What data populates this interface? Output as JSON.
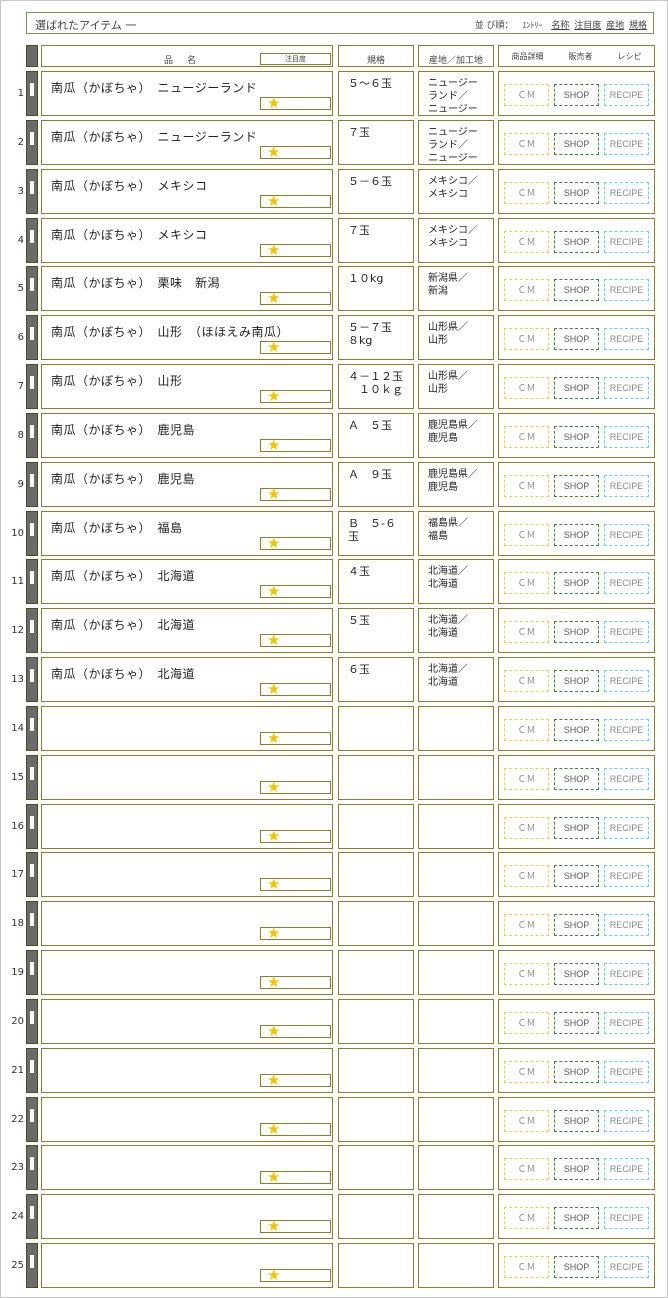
{
  "header": {
    "title": "選ばれたアイテム 一",
    "sort_prefix": "並 び順：",
    "sort_entry": "ｴﾝﾄﾘｰ",
    "sort_options": [
      "名称",
      "注目度",
      "産地",
      "規格"
    ]
  },
  "columns": {
    "name": "品名",
    "attention": "注目度",
    "spec": "規格",
    "origin": "産地／加工地",
    "detail": "商品詳細",
    "seller": "販売者",
    "recipe": "レシピ"
  },
  "buttons": {
    "cm": "ＣＭ",
    "shop": "SHOP",
    "recipe": "RECIPE"
  },
  "rows": [
    {
      "num": "1",
      "name": "南瓜（かぼちゃ）　ニュージーランド",
      "spec": "５～６玉",
      "origin": "ニュージー\nランド／\nニュージー"
    },
    {
      "num": "2",
      "name": "南瓜（かぼちゃ）　ニュージーランド",
      "spec": "７玉",
      "origin": "ニュージー\nランド／\nニュージー"
    },
    {
      "num": "3",
      "name": "南瓜（かぼちゃ）　メキシコ",
      "spec": "５－６玉",
      "origin": "メキシコ／\nメキシコ"
    },
    {
      "num": "4",
      "name": "南瓜（かぼちゃ）　メキシコ",
      "spec": "７玉",
      "origin": "メキシコ／\nメキシコ"
    },
    {
      "num": "5",
      "name": "南瓜（かぼちゃ）　栗味　新潟",
      "spec": "１０kg",
      "origin": "新潟県／\n新潟"
    },
    {
      "num": "6",
      "name": "南瓜（かぼちゃ）　山形　（ほほえみ南瓜）",
      "spec": "５－７玉\n８kg",
      "origin": "山形県／\n山形"
    },
    {
      "num": "7",
      "name": "南瓜（かぼちゃ）　山形",
      "spec": "４－１２玉\n　１０ｋｇ",
      "origin": "山形県／\n山形"
    },
    {
      "num": "8",
      "name": "南瓜（かぼちゃ）　鹿児島",
      "spec": "Ａ　５玉",
      "origin": "鹿児島県／\n鹿児島"
    },
    {
      "num": "9",
      "name": "南瓜（かぼちゃ）　鹿児島",
      "spec": "Ａ　９玉",
      "origin": "鹿児島県／\n鹿児島"
    },
    {
      "num": "10",
      "name": "南瓜（かぼちゃ）　福島",
      "spec": "Ｂ　５-６\n玉",
      "origin": "福島県／\n福島"
    },
    {
      "num": "11",
      "name": "南瓜（かぼちゃ）　北海道",
      "spec": "４玉",
      "origin": "北海道／\n北海道"
    },
    {
      "num": "12",
      "name": "南瓜（かぼちゃ）　北海道",
      "spec": "５玉",
      "origin": "北海道／\n北海道"
    },
    {
      "num": "13",
      "name": "南瓜（かぼちゃ）　北海道",
      "spec": "６玉",
      "origin": "北海道／\n北海道"
    },
    {
      "num": "14",
      "name": "",
      "spec": "",
      "origin": ""
    },
    {
      "num": "15",
      "name": "",
      "spec": "",
      "origin": ""
    },
    {
      "num": "16",
      "name": "",
      "spec": "",
      "origin": ""
    },
    {
      "num": "17",
      "name": "",
      "spec": "",
      "origin": ""
    },
    {
      "num": "18",
      "name": "",
      "spec": "",
      "origin": ""
    },
    {
      "num": "19",
      "name": "",
      "spec": "",
      "origin": ""
    },
    {
      "num": "20",
      "name": "",
      "spec": "",
      "origin": ""
    },
    {
      "num": "21",
      "name": "",
      "spec": "",
      "origin": ""
    },
    {
      "num": "22",
      "name": "",
      "spec": "",
      "origin": ""
    },
    {
      "num": "23",
      "name": "",
      "spec": "",
      "origin": ""
    },
    {
      "num": "24",
      "name": "",
      "spec": "",
      "origin": ""
    },
    {
      "num": "25",
      "name": "",
      "spec": "",
      "origin": ""
    }
  ],
  "colors": {
    "title_border": "#6b9a55",
    "cell_border": "#8b7f2a",
    "star": "#f2c500",
    "cm_border": "#e8d44a",
    "shop_border": "#3a8a3a",
    "recipe_border": "#5cd6e8"
  },
  "icons": {
    "star": "star-icon",
    "handle": "row-handle-icon"
  }
}
